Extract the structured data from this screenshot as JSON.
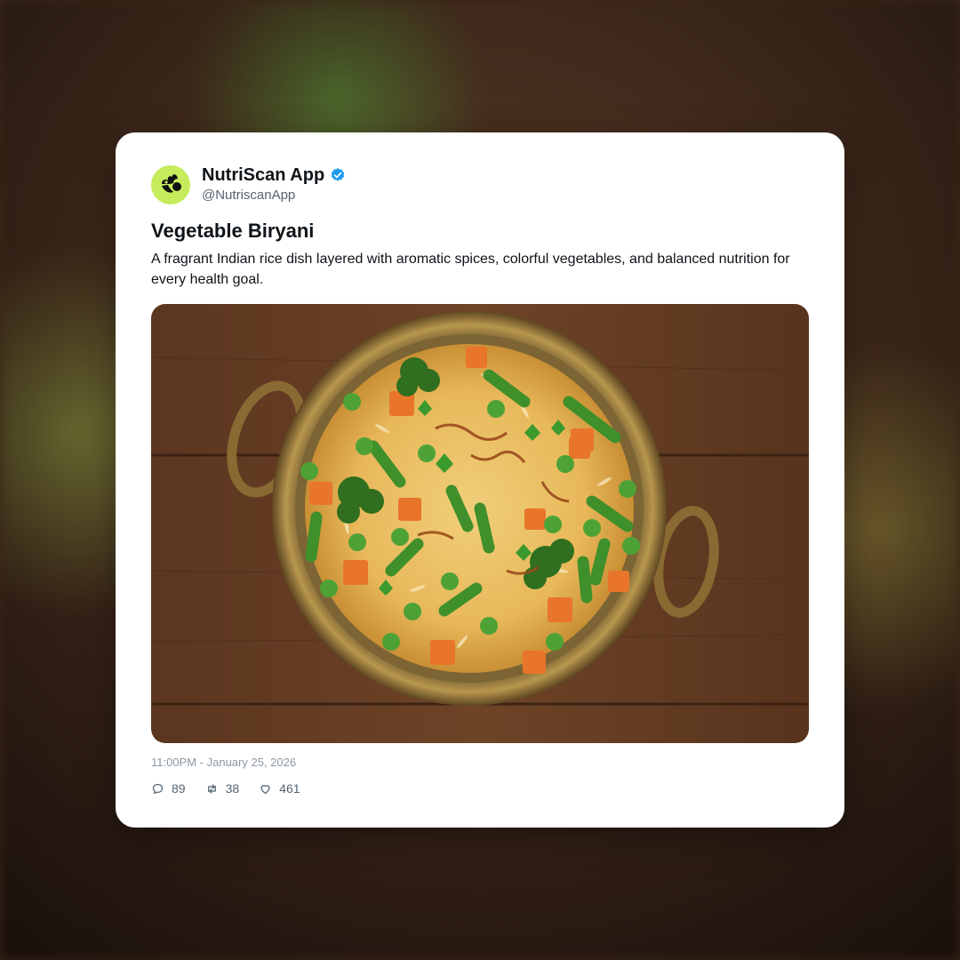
{
  "post": {
    "display_name": "NutriScan App",
    "handle": "@NutriscanApp",
    "verified": true,
    "title": "Vegetable Biryani",
    "description": "A fragrant Indian rice dish layered with aromatic spices, colorful vegetables, and balanced nutrition for every health goal.",
    "timestamp": "11:00PM - January 25, 2026",
    "image_icon": "vegetable-biryani-photo",
    "avatar_icon": "nutriscan-logo-icon"
  },
  "stats": {
    "replies": "89",
    "reposts": "38",
    "likes": "461"
  },
  "colors": {
    "avatar_bg": "#c6ec5c",
    "verified_blue": "#1d9bf0",
    "text_primary": "#0f1419",
    "text_secondary": "#536471"
  }
}
